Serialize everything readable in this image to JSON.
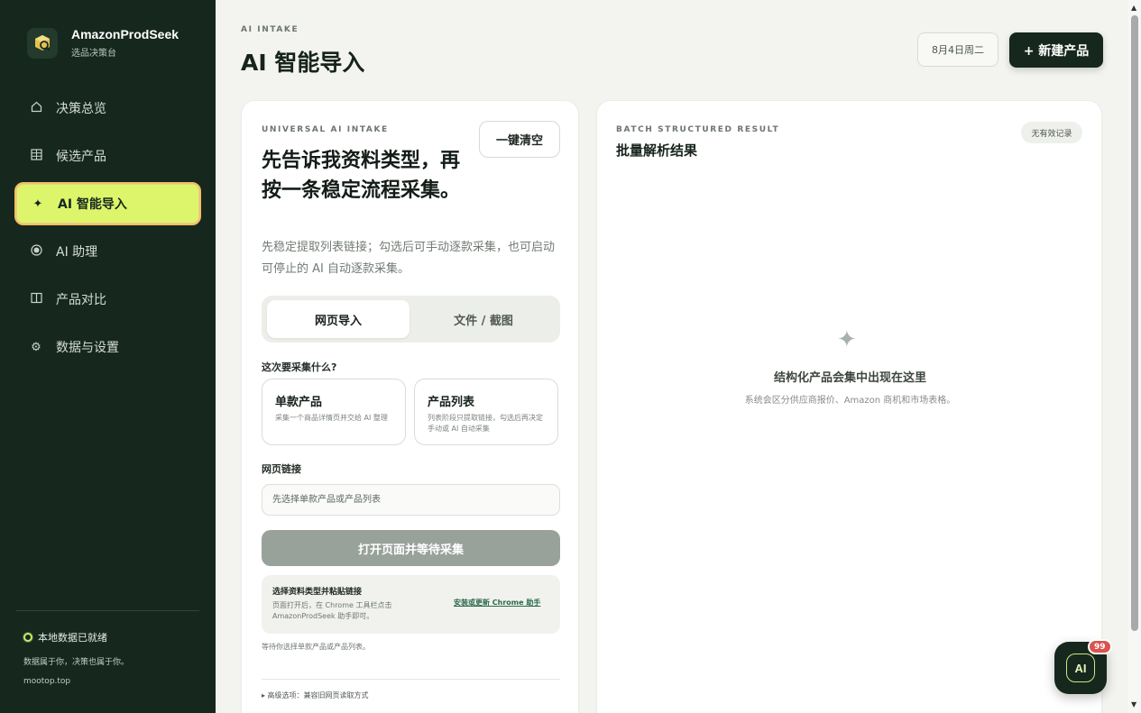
{
  "app": {
    "name": "AmazonProdSeek",
    "subtitle": "选品决策台"
  },
  "sidebar": {
    "items": [
      {
        "label": "决策总览",
        "icon": "home-icon",
        "active": false
      },
      {
        "label": "候选产品",
        "icon": "grid-icon",
        "active": false
      },
      {
        "label": "AI 智能导入",
        "icon": "sparkle-icon",
        "active": true
      },
      {
        "label": "AI 助理",
        "icon": "radio-icon",
        "active": false
      },
      {
        "label": "产品对比",
        "icon": "columns-icon",
        "active": false
      },
      {
        "label": "数据与设置",
        "icon": "gear-icon",
        "active": false
      }
    ],
    "footer": {
      "status": "本地数据已就绪",
      "tagline": "数据属于你，决策也属于你。",
      "site": "mootop.top"
    }
  },
  "header": {
    "eyebrow": "AI INTAKE",
    "title": "AI 智能导入",
    "date": "8月4日周二",
    "new_button": "+ 新建产品"
  },
  "intake": {
    "eyebrow": "UNIVERSAL AI INTAKE",
    "clear_button": "一键清空",
    "headline": "先告诉我资料类型，再按一条稳定流程采集。",
    "description": "先稳定提取列表链接；勾选后可手动逐款采集，也可启动可停止的 AI 自动逐款采集。",
    "tabs": [
      {
        "label": "网页导入",
        "active": true
      },
      {
        "label": "文件 / 截图",
        "active": false
      }
    ],
    "question": "这次要采集什么?",
    "options": [
      {
        "title": "单款产品",
        "desc": "采集一个商品详情页并交给 AI 整理"
      },
      {
        "title": "产品列表",
        "desc": "列表阶段只提取链接，勾选后再决定手动或 AI 自动采集"
      }
    ],
    "url_label": "网页链接",
    "url_placeholder": "先选择单款产品或产品列表",
    "url_value": "",
    "open_button": "打开页面并等待采集",
    "tip": {
      "title": "选择资料类型并粘贴链接",
      "desc": "页面打开后，在 Chrome 工具栏点击 AmazonProdSeek 助手即可。",
      "link": "安装或更新 Chrome 助手"
    },
    "waiting": "等待你选择单款产品或产品列表。",
    "advanced": "▸ 高级选项：兼容旧网页读取方式"
  },
  "result": {
    "eyebrow": "BATCH STRUCTURED RESULT",
    "title": "批量解析结果",
    "badge": "无有效记录",
    "empty_title": "结构化产品会集中出现在这里",
    "empty_desc": "系统会区分供应商报价、Amazon 商机和市场表格。"
  },
  "assistant": {
    "label": "AI",
    "badge": "99"
  },
  "colors": {
    "sidebar_bg": "#16281e",
    "accent": "#ddf56b",
    "accent_border": "#f2bf63",
    "badge_red": "#d9534f"
  }
}
